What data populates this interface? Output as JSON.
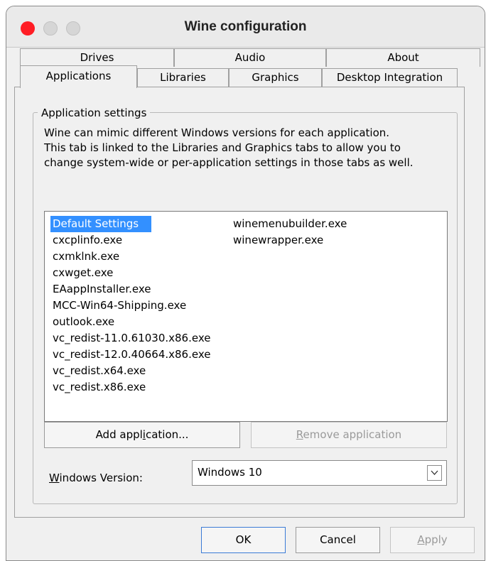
{
  "window": {
    "title": "Wine configuration"
  },
  "tabs": {
    "back_row": [
      "Drives",
      "Audio",
      "About"
    ],
    "front_row": [
      "Applications",
      "Libraries",
      "Graphics",
      "Desktop Integration"
    ],
    "active": "Applications"
  },
  "app_settings": {
    "legend": "Application settings",
    "description": [
      "Wine can mimic different Windows versions for each application.",
      "This tab is linked to the Libraries and Graphics tabs to allow you to",
      "change system-wide or per-application settings in those tabs as well."
    ],
    "applications": [
      "Default Settings",
      "cxcplinfo.exe",
      "cxmklnk.exe",
      "cxwget.exe",
      "EAappInstaller.exe",
      "MCC-Win64-Shipping.exe",
      "outlook.exe",
      "vc_redist-11.0.61030.x86.exe",
      "vc_redist-12.0.40664.x86.exe",
      "vc_redist.x64.exe",
      "vc_redist.x86.exe",
      "winemenubuilder.exe",
      "winewrapper.exe"
    ],
    "selected_application": "Default Settings",
    "add_button": {
      "before": "Add appl",
      "accel": "i",
      "after": "cation..."
    },
    "remove_button": {
      "before": "",
      "accel": "R",
      "after": "emove application"
    },
    "version_label": {
      "before": "",
      "accel": "W",
      "after": "indows Version:"
    },
    "version_value": "Windows 10"
  },
  "dialog_buttons": {
    "ok": "OK",
    "cancel": "Cancel",
    "apply": {
      "before": "",
      "accel": "A",
      "after": "pply"
    }
  },
  "colors": {
    "close": "#ff1d25",
    "selection": "#3390ff",
    "window_bg": "#f0f0f0"
  }
}
